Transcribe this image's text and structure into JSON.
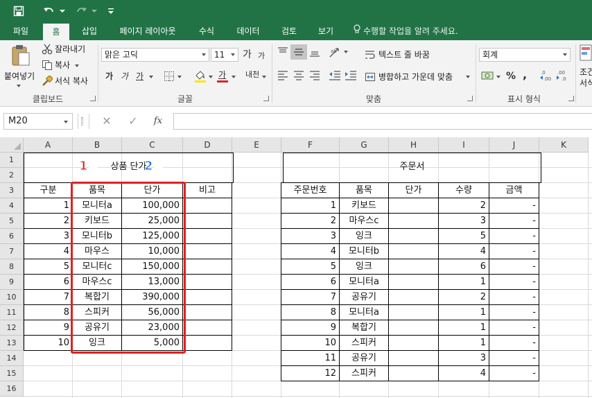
{
  "quick_access": {
    "save": "save-icon",
    "undo": "undo-icon",
    "redo": "redo-icon",
    "customize": "customize-qat-icon"
  },
  "tabs": [
    "파일",
    "홈",
    "삽입",
    "페이지 레이아웃",
    "수식",
    "데이터",
    "검토",
    "보기"
  ],
  "tell_me": "수행할 작업을 알려 주세요.",
  "clipboard": {
    "paste": "붙여넣기",
    "cut": "잘라내기",
    "copy": "복사",
    "format_painter": "서식 복사",
    "label": "클립보드"
  },
  "font": {
    "name": "맑은 고딕",
    "size": "11",
    "grow": "가",
    "shrink": "가",
    "bold": "가",
    "italic": "가",
    "underline": "가",
    "font_color_glyph": "가",
    "phonetic": "내천",
    "label": "글꼴"
  },
  "alignment": {
    "wrap": "텍스트 줄 바꿈",
    "merge": "병합하고 가운데 맞춤",
    "label": "맞춤"
  },
  "number": {
    "format": "회계",
    "percent": "%",
    "comma": ",",
    "label": "표시 형식"
  },
  "styles": {
    "partial_1": "조건",
    "partial_2": "서식"
  },
  "namebox": "M20",
  "formula": {
    "cancel": "✕",
    "enter": "✓",
    "fx": "fx",
    "value": ""
  },
  "columns": [
    "A",
    "B",
    "C",
    "D",
    "E",
    "F",
    "G",
    "H",
    "I",
    "J",
    "K"
  ],
  "rows": [
    "1",
    "2",
    "3",
    "4",
    "5",
    "6",
    "7",
    "8",
    "9",
    "10",
    "11",
    "12",
    "13",
    "14",
    "15",
    "16"
  ],
  "price_table": {
    "title": "상품 단가",
    "headers": [
      "구분",
      "품목",
      "단가",
      "비고"
    ],
    "rows": [
      [
        "1",
        "모니터a",
        "100,000",
        ""
      ],
      [
        "2",
        "키보드",
        "25,000",
        ""
      ],
      [
        "3",
        "모니터b",
        "125,000",
        ""
      ],
      [
        "4",
        "마우스",
        "10,000",
        ""
      ],
      [
        "5",
        "모니터c",
        "150,000",
        ""
      ],
      [
        "6",
        "마우스c",
        "13,000",
        ""
      ],
      [
        "7",
        "복합기",
        "390,000",
        ""
      ],
      [
        "8",
        "스피커",
        "56,000",
        ""
      ],
      [
        "9",
        "공유기",
        "23,000",
        ""
      ],
      [
        "10",
        "잉크",
        "5,000",
        ""
      ]
    ]
  },
  "order_table": {
    "title": "주문서",
    "headers": [
      "주문번호",
      "품목",
      "단가",
      "수량",
      "금액"
    ],
    "rows": [
      [
        "1",
        "키보드",
        "",
        "2",
        "-"
      ],
      [
        "2",
        "마우스c",
        "",
        "3",
        "-"
      ],
      [
        "3",
        "잉크",
        "",
        "5",
        "-"
      ],
      [
        "4",
        "모니터b",
        "",
        "4",
        "-"
      ],
      [
        "5",
        "잉크",
        "",
        "6",
        "-"
      ],
      [
        "6",
        "모니터a",
        "",
        "1",
        "-"
      ],
      [
        "7",
        "공유기",
        "",
        "2",
        "-"
      ],
      [
        "8",
        "모니터a",
        "",
        "1",
        "-"
      ],
      [
        "9",
        "복합기",
        "",
        "1",
        "-"
      ],
      [
        "10",
        "스피커",
        "",
        "1",
        "-"
      ],
      [
        "11",
        "공유기",
        "",
        "3",
        "-"
      ],
      [
        "12",
        "스피커",
        "",
        "4",
        "-"
      ]
    ]
  },
  "annotations": {
    "col1": "1열",
    "col2": "2열",
    "col1_color": "#e02020",
    "col2_color": "#1e6fd9"
  },
  "colors": {
    "excel_green": "#217346",
    "highlight_red": "#e02020"
  }
}
